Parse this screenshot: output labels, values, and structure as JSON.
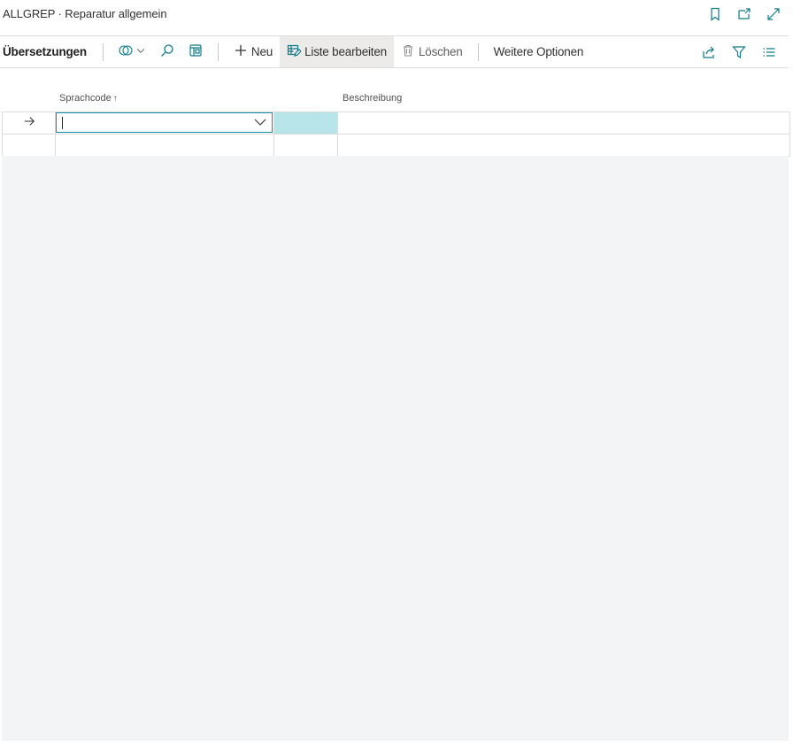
{
  "window": {
    "title": "ALLGREP · Reparatur allgemein",
    "icons": [
      "bookmark-icon",
      "open-in-new-window-icon",
      "expand-icon"
    ]
  },
  "actionbar": {
    "page_caption": "Übersetzungen",
    "new_label": "Neu",
    "edit_list_label": "Liste bearbeiten",
    "delete_label": "Löschen",
    "more_options_label": "Weitere Optionen",
    "left_icons": [
      "copilot-icon",
      "search-icon",
      "view-icon"
    ],
    "right_icons": [
      "share-icon",
      "filter-icon",
      "list-view-icon"
    ]
  },
  "table": {
    "columns": [
      {
        "label": "Sprachcode",
        "sort": "ascending"
      },
      {
        "label": "Beschreibung"
      }
    ],
    "sort_indicator": "↑",
    "rows": [
      {
        "indicator": "→",
        "language_code": "",
        "description": "",
        "editing": true
      },
      {
        "indicator": "",
        "language_code": "",
        "description": ""
      }
    ]
  },
  "colors": {
    "accent": "#108fa0",
    "selected_cell": "#b6e4e8",
    "empty_area": "#f3f4f6"
  }
}
